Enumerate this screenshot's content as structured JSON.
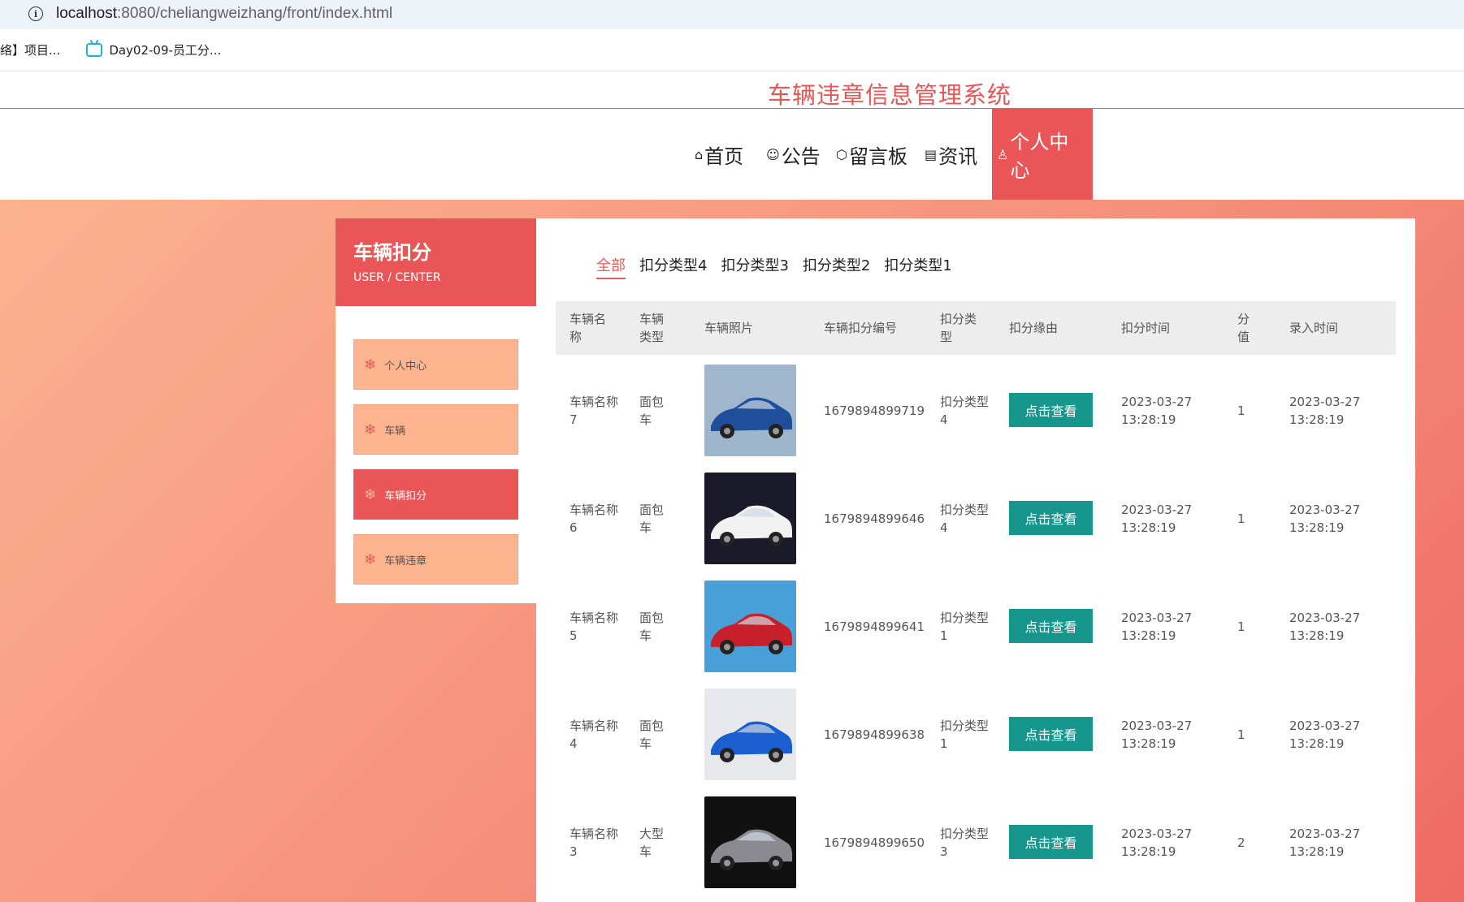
{
  "browser": {
    "url_host": "localhost",
    "url_path": ":8080/cheliangweizhang/front/index.html",
    "bookmarks": [
      "络】项目...",
      "Day02-09-员工分..."
    ]
  },
  "site": {
    "title": "车辆违章信息管理系统"
  },
  "nav": {
    "items": [
      {
        "icon": "home-icon",
        "label": "首页",
        "glyph": "⌂"
      },
      {
        "icon": "palette-icon",
        "label": "公告",
        "glyph": "☺"
      },
      {
        "icon": "cube-icon",
        "label": "留言板",
        "glyph": "⬡"
      },
      {
        "icon": "clipboard-icon",
        "label": "资讯",
        "glyph": "▤"
      },
      {
        "icon": "user-icon",
        "label": "个人中心",
        "glyph": "♙"
      }
    ],
    "active": "个人中心"
  },
  "sidebar": {
    "title": "车辆扣分",
    "subtitle": "USER / CENTER",
    "items": [
      {
        "label": "个人中心"
      },
      {
        "label": "车辆"
      },
      {
        "label": "车辆扣分"
      },
      {
        "label": "车辆违章"
      }
    ],
    "active": "车辆扣分"
  },
  "tabs": {
    "items": [
      "全部",
      "扣分类型4",
      "扣分类型3",
      "扣分类型2",
      "扣分类型1"
    ],
    "active": "全部"
  },
  "table": {
    "headers": {
      "name": "车辆名称",
      "type": "车辆类型",
      "photo": "车辆照片",
      "code": "车辆扣分编号",
      "deduct_type": "扣分类型",
      "reason": "扣分缘由",
      "time": "扣分时间",
      "score": "分值",
      "entry_time": "录入时间"
    },
    "view_label": "点击查看",
    "rows": [
      {
        "name": "车辆名称7",
        "type": "面包车",
        "code": "1679894899719",
        "deduct_type": "扣分类型4",
        "time": "2023-03-27 13:28:19",
        "score": "1",
        "entry_time": "2023-03-27 13:28:19",
        "photo_colors": [
          "#9fb6cc",
          "#1f4f9a"
        ]
      },
      {
        "name": "车辆名称6",
        "type": "面包车",
        "code": "1679894899646",
        "deduct_type": "扣分类型4",
        "time": "2023-03-27 13:28:19",
        "score": "1",
        "entry_time": "2023-03-27 13:28:19",
        "photo_colors": [
          "#1a1a2a",
          "#f2f2f2"
        ]
      },
      {
        "name": "车辆名称5",
        "type": "面包车",
        "code": "1679894899641",
        "deduct_type": "扣分类型1",
        "time": "2023-03-27 13:28:19",
        "score": "1",
        "entry_time": "2023-03-27 13:28:19",
        "photo_colors": [
          "#4aa0d8",
          "#c8202a"
        ]
      },
      {
        "name": "车辆名称4",
        "type": "面包车",
        "code": "1679894899638",
        "deduct_type": "扣分类型1",
        "time": "2023-03-27 13:28:19",
        "score": "1",
        "entry_time": "2023-03-27 13:28:19",
        "photo_colors": [
          "#e6e8ec",
          "#1a5fd0"
        ]
      },
      {
        "name": "车辆名称3",
        "type": "大型车",
        "code": "1679894899650",
        "deduct_type": "扣分类型3",
        "time": "2023-03-27 13:28:19",
        "score": "2",
        "entry_time": "2023-03-27 13:28:19",
        "photo_colors": [
          "#111111",
          "#8a8a90"
        ]
      }
    ]
  },
  "colors": {
    "brand_red": "#ea5657",
    "sidebar_item": "#fdb48f",
    "button_teal": "#17968d"
  }
}
